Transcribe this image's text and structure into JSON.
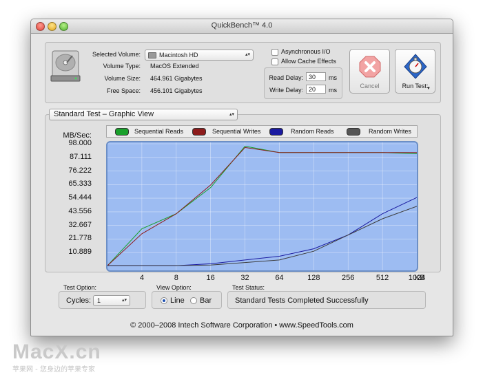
{
  "window": {
    "title": "QuickBench™ 4.0"
  },
  "volume": {
    "selected_label": "Selected Volume:",
    "selected_value": "Macintosh HD",
    "type_label": "Volume Type:",
    "type_value": "MacOS Extended",
    "size_label": "Volume Size:",
    "size_value": "464.961 Gigabytes",
    "free_label": "Free Space:",
    "free_value": "456.101 Gigabytes"
  },
  "options": {
    "async_label": "Asynchronous I/O",
    "cache_label": "Allow Cache Effects",
    "read_delay_label": "Read Delay:",
    "read_delay_value": "30",
    "write_delay_label": "Write Delay:",
    "write_delay_value": "20",
    "unit": "ms"
  },
  "buttons": {
    "cancel": "Cancel",
    "run": "Run Test:"
  },
  "view_select": "Standard Test – Graphic View",
  "legend": [
    "Sequential Reads",
    "Sequential Writes",
    "Random Reads",
    "Random Writes"
  ],
  "colors": {
    "sequential_reads": "#19a02c",
    "sequential_writes": "#8c1b1b",
    "random_reads": "#1a1aa0",
    "random_writes": "#3c3c3c",
    "plot_bg": "#9dbcf2"
  },
  "chart_data": {
    "type": "line",
    "ylabel": "MB/Sec:",
    "xlabel": "KB",
    "x": [
      "4",
      "8",
      "16",
      "32",
      "64",
      "128",
      "256",
      "512",
      "1024"
    ],
    "y_ticks": [
      "98.000",
      "87.111",
      "76.222",
      "65.333",
      "54.444",
      "43.556",
      "32.667",
      "21.778",
      "10.889"
    ],
    "ylim": [
      0,
      98
    ],
    "series": [
      {
        "name": "Sequential Reads",
        "values": [
          0.5,
          30,
          42,
          63,
          96,
          91,
          91,
          91,
          91,
          90
        ]
      },
      {
        "name": "Sequential Writes",
        "values": [
          0.5,
          26,
          42,
          65,
          95,
          91,
          91,
          91,
          91,
          91
        ]
      },
      {
        "name": "Random Reads",
        "values": [
          0.5,
          0.5,
          0.5,
          2,
          5,
          8,
          14,
          25,
          42,
          55
        ]
      },
      {
        "name": "Random Writes",
        "values": [
          0.5,
          0.5,
          0.5,
          1,
          3,
          5,
          12,
          25,
          38,
          48
        ]
      }
    ]
  },
  "bottom": {
    "test_option_label": "Test Option:",
    "cycles_label": "Cycles:",
    "cycles_value": "1",
    "view_option_label": "View Option:",
    "line_label": "Line",
    "bar_label": "Bar",
    "status_label": "Test Status:",
    "status_value": "Standard Tests Completed Successfully"
  },
  "footer": "© 2000–2008 Intech Software Corporation • www.SpeedTools.com",
  "watermark": {
    "brand": "MacX.cn",
    "tagline": "苹果网 - 您身边的苹果专家"
  }
}
